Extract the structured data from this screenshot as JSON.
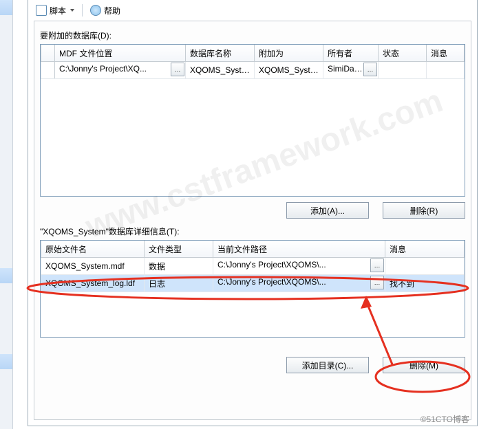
{
  "toolbar": {
    "script_label": "脚本",
    "help_label": "帮助"
  },
  "top": {
    "title": "要附加的数据库(D):",
    "cols": {
      "c0": "",
      "c1": "MDF 文件位置",
      "c2": "数据库名称",
      "c3": "附加为",
      "c4": "所有者",
      "c5": "状态",
      "c6": "消息"
    },
    "row": {
      "mdf": "C:\\Jonny's Project\\XQ...",
      "dbname": "XQOMS_System",
      "attachas": "XQOMS_System",
      "owner": "SimiDat...",
      "status": "",
      "message": ""
    },
    "btn_add": "添加(A)...",
    "btn_remove": "删除(R)"
  },
  "bot": {
    "title_prefix": "\"XQOMS_System\"数据库详细信息(T):",
    "cols": {
      "c0": "原始文件名",
      "c1": "文件类型",
      "c2": "当前文件路径",
      "c3": "消息"
    },
    "rows": [
      {
        "file": "XQOMS_System.mdf",
        "type": "数据",
        "path": "C:\\Jonny's Project\\XQOMS\\...",
        "msg": ""
      },
      {
        "file": "XQOMS_System_log.ldf",
        "type": "日志",
        "path": "C:\\Jonny's Project\\XQOMS\\...",
        "msg": "找不到"
      }
    ],
    "btn_adddir": "添加目录(C)...",
    "btn_remove": "删除(M)"
  },
  "watermark_main": "www.cstframework.com",
  "watermark_footer": "©51CTO博客"
}
